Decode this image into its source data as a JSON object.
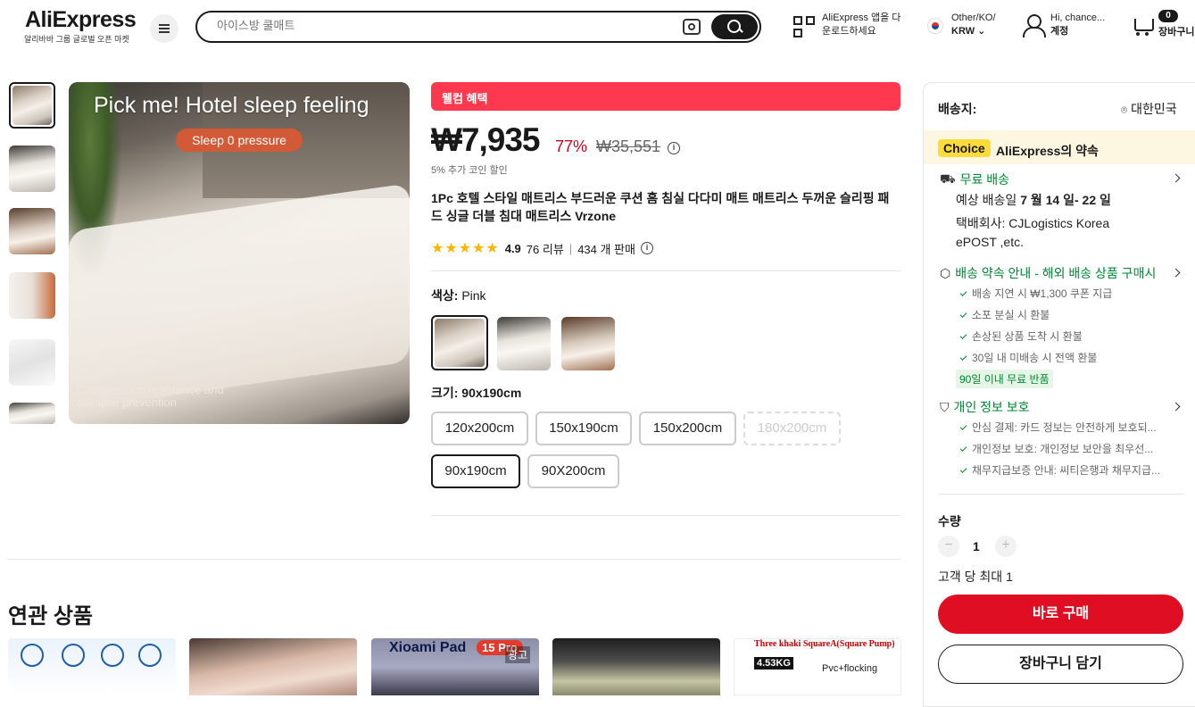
{
  "header": {
    "logo": "AliExpress",
    "logo_sub": "알리바바 그룹 글로벌 오픈 마켓",
    "search_placeholder": "아이스방 쿨매트",
    "app_line1": "AliExpress 앱을 다",
    "app_line2": "운로드하세요",
    "lang_line1": "Other/KO/",
    "lang_line2": "KRW",
    "user_line1": "Hi, chance...",
    "user_line2": "계정",
    "cart_count": "0",
    "cart_label": "장바구니"
  },
  "gallery": {
    "main_title": "Pick me!  Hotel sleep feeling",
    "pill": "Sleep 0 pressure",
    "caption": "Compression resistance and collapse prevention"
  },
  "product": {
    "welcome": "웰컴 혜택",
    "price": "₩7,935",
    "discount": "77%",
    "old_price": "₩35,551",
    "coin": "5% 추가 코인 할인",
    "title": "1Pc 호텔 스타일 매트리스 부드러운 쿠션 홈 침실 다다미 매트 매트리스 두꺼운 슬리핑 패드 싱글 더블 침대 매트리스 Vrzone",
    "rating": "4.9",
    "reviews": "76 리뷰",
    "sold": "434 개 판매",
    "color_label": "색상: ",
    "color_value": "Pink",
    "size_label": "크기: 90x190cm",
    "sizes": [
      "120x200cm",
      "150x190cm",
      "150x200cm",
      "180x200cm",
      "90x190cm",
      "90X200cm"
    ]
  },
  "related": {
    "title": "연관 상품",
    "card3_title": "Xioami Pad",
    "card3_badge": "15 Pro",
    "card3_ad": "광고",
    "card5_title": "Three khaki SquareA(Square Pump)",
    "card5_weight": "4.53KG",
    "card5_material": "Pvc+flocking"
  },
  "panel": {
    "ship_label": "배송지:",
    "ship_dest": "대한민국",
    "choice_badge": "Choice",
    "choice_text": "AliExpress의 약속",
    "free_ship": "무료 배송",
    "delivery_prefix": "예상 배송일 ",
    "delivery_date": "7 월 14 일- 22 일",
    "courier_line1": "택배회사:  CJLogistics  Korea",
    "courier_line2": "ePOST ,etc.",
    "promise_title": "배송 약속 안내 - 해외 배송 상품 구매시",
    "promise_items": [
      "배송 지연 시 ₩1,300 쿠폰 지급",
      "소포 분실 시 환불",
      "손상된 상품 도착 시 환불",
      "30일 내 미배송 시 전액 환불"
    ],
    "return_badge": "90일 이내 무료 반품",
    "privacy_title": "개인 정보 보호",
    "privacy_items": [
      "안심 결제: 카드 정보는 안전하게 보호되...",
      "개인정보 보호: 개인정보 보안을 최우선...",
      "채무지급보증 안내: 씨티은행과 채무지급..."
    ],
    "qty_label": "수량",
    "qty_value": "1",
    "max_label": "고객 당 최대 1",
    "buy_label": "바로 구매",
    "cart_label": "장바구니 담기"
  },
  "colors": {
    "accent": "#e62e04",
    "discount": "#d3031c",
    "buy": "#e00e22",
    "green": "#018733"
  }
}
